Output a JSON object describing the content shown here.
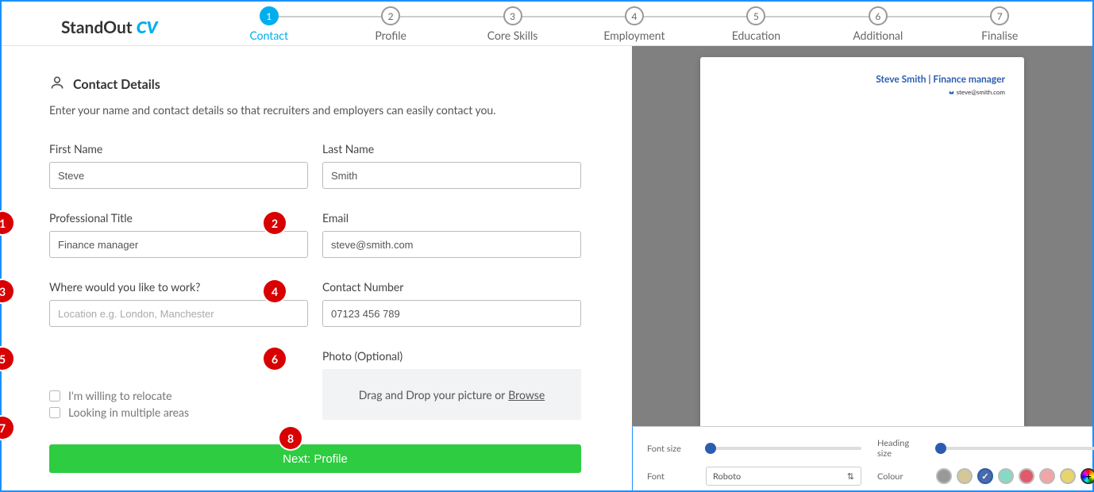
{
  "brand": {
    "text1": "StandOut ",
    "text2": "CV"
  },
  "steps": [
    {
      "num": "1",
      "label": "Contact",
      "active": true
    },
    {
      "num": "2",
      "label": "Profile",
      "active": false
    },
    {
      "num": "3",
      "label": "Core Skills",
      "active": false
    },
    {
      "num": "4",
      "label": "Employment",
      "active": false
    },
    {
      "num": "5",
      "label": "Education",
      "active": false
    },
    {
      "num": "6",
      "label": "Additional",
      "active": false
    },
    {
      "num": "7",
      "label": "Finalise",
      "active": false
    }
  ],
  "section": {
    "title": "Contact Details",
    "sub": "Enter your name and contact details so that recruiters and employers can easily contact you."
  },
  "fields": {
    "first_name": {
      "label": "First Name",
      "value": "Steve"
    },
    "last_name": {
      "label": "Last Name",
      "value": "Smith"
    },
    "prof_title": {
      "label": "Professional Title",
      "value": "Finance manager"
    },
    "email": {
      "label": "Email",
      "value": "steve@smith.com"
    },
    "location": {
      "label": "Where would you like to work?",
      "value": "",
      "placeholder": "Location e.g. London, Manchester"
    },
    "phone": {
      "label": "Contact Number",
      "value": "07123 456 789"
    },
    "photo": {
      "label": "Photo (Optional)",
      "drop_text": "Drag and Drop your picture or ",
      "browse": "Browse"
    }
  },
  "checks": {
    "relocate": "I'm willing to relocate",
    "multi_area": "Looking in multiple areas"
  },
  "next_button": "Next: Profile",
  "annotations": [
    "1",
    "2",
    "3",
    "4",
    "5",
    "6",
    "7",
    "8"
  ],
  "preview": {
    "name_line": "Steve Smith | Finance manager",
    "email": "steve@smith.com"
  },
  "toolbar": {
    "font_size_label": "Font size",
    "heading_size_label": "Heading size",
    "font_label": "Font",
    "font_value": "Roboto",
    "colour_label": "Colour",
    "swatches": [
      "#999999",
      "#d6c798",
      "#4b6aa8",
      "#88d9c4",
      "#e05a6a",
      "#f2a5a7",
      "#e8d46b"
    ]
  }
}
